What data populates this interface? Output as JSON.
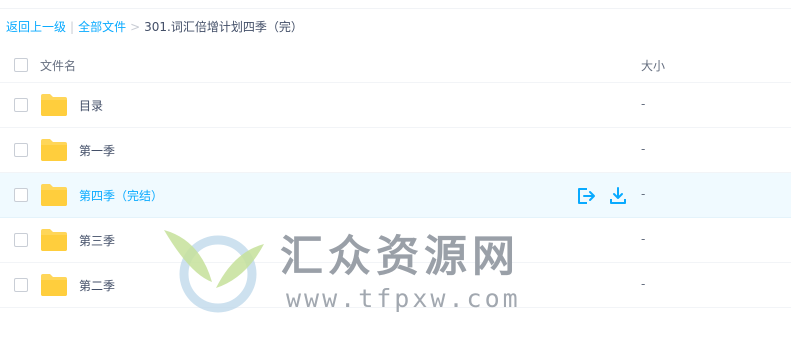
{
  "breadcrumb": {
    "back": "返回上一级",
    "all_files": "全部文件",
    "separator": ">",
    "current": "301.词汇倍增计划四季（完）"
  },
  "table": {
    "col_name": "文件名",
    "col_size": "大小",
    "rows": [
      {
        "name": "目录",
        "size": "-"
      },
      {
        "name": "第一季",
        "size": "-"
      },
      {
        "name": "第四季（完结）",
        "size": "-",
        "hovered": true
      },
      {
        "name": "第三季",
        "size": "-"
      },
      {
        "name": "第二季",
        "size": "-"
      }
    ]
  },
  "icons": {
    "folder": "folder-icon",
    "share": "share-icon",
    "download": "download-icon"
  },
  "watermark": {
    "text": "汇众资源网",
    "url": "www.tfpxw.com"
  },
  "colors": {
    "accent": "#09aaff",
    "folder": "#ffd659",
    "hover_row": "#f0faff"
  }
}
